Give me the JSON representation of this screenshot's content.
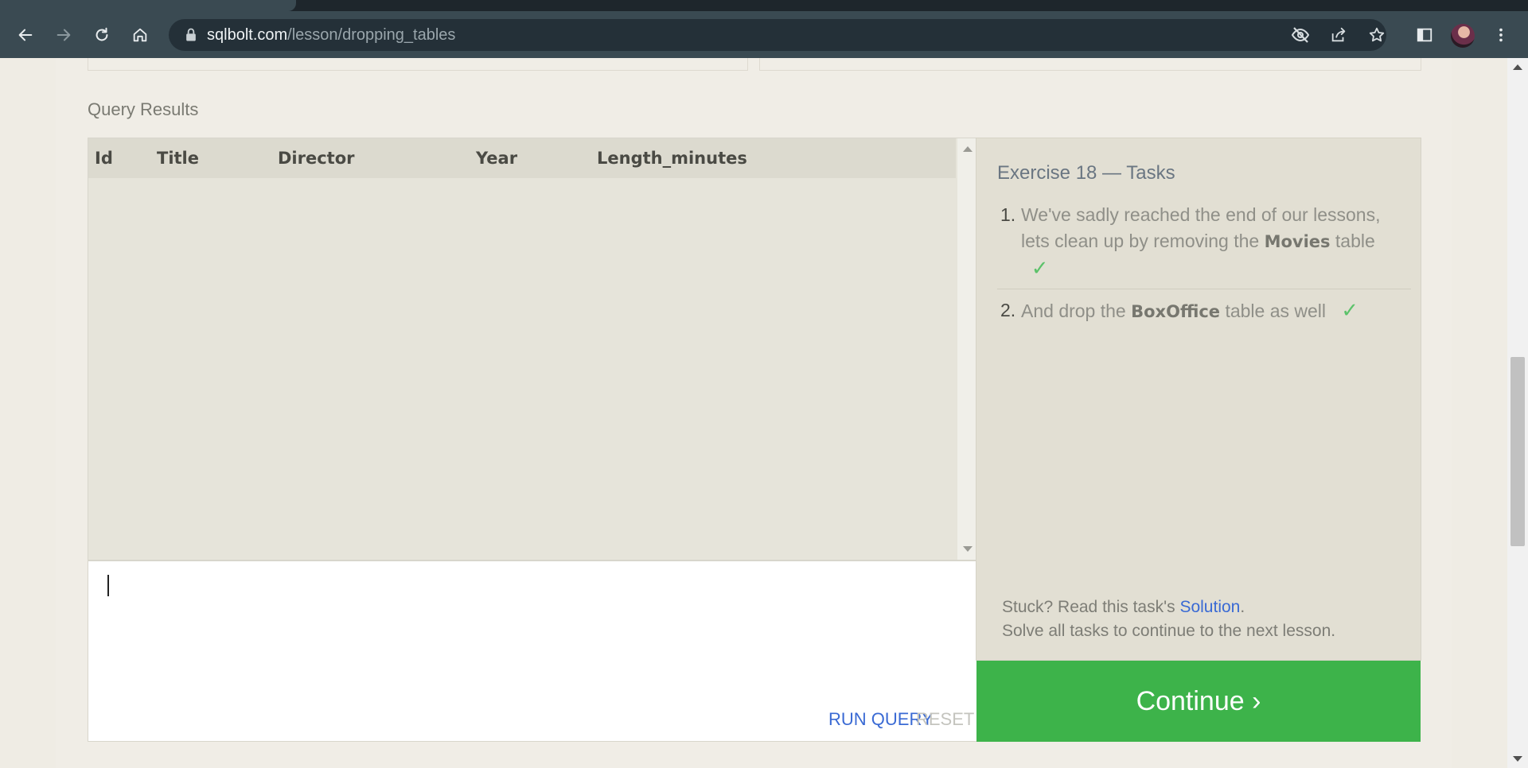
{
  "browser": {
    "url_host": "sqlbolt.com",
    "url_path": "/lesson/dropping_tables",
    "icons": [
      "back-icon",
      "forward-icon",
      "reload-icon",
      "home-icon",
      "lock-icon",
      "eye-off-icon",
      "share-icon",
      "star-icon",
      "sidepanel-icon",
      "avatar",
      "menu-icon"
    ]
  },
  "main": {
    "query_results_label": "Query Results",
    "columns": [
      "Id",
      "Title",
      "Director",
      "Year",
      "Length_minutes"
    ],
    "rows": []
  },
  "editor": {
    "value": "",
    "run_label": "RUN QUERY",
    "reset_label": "RESET"
  },
  "tasks": {
    "title": "Exercise 18 — Tasks",
    "items": [
      {
        "num": "1.",
        "pre": "We've sadly reached the end of our lessons, lets clean up by removing the ",
        "bold": "Movies",
        "post": " table",
        "check": "✓"
      },
      {
        "num": "2.",
        "pre": "And drop the ",
        "bold": "BoxOffice",
        "post": " table as well",
        "check": "✓"
      }
    ],
    "stuck_pre": "Stuck? Read this task's ",
    "solution_link": "Solution",
    "stuck_post": ".",
    "solve_all": "Solve all tasks to continue to the next lesson.",
    "continue_label": "Continue ›"
  },
  "colors": {
    "accent_link": "#3a6ad4",
    "continue_green": "#3db34a",
    "check_green": "#5cc26a"
  }
}
